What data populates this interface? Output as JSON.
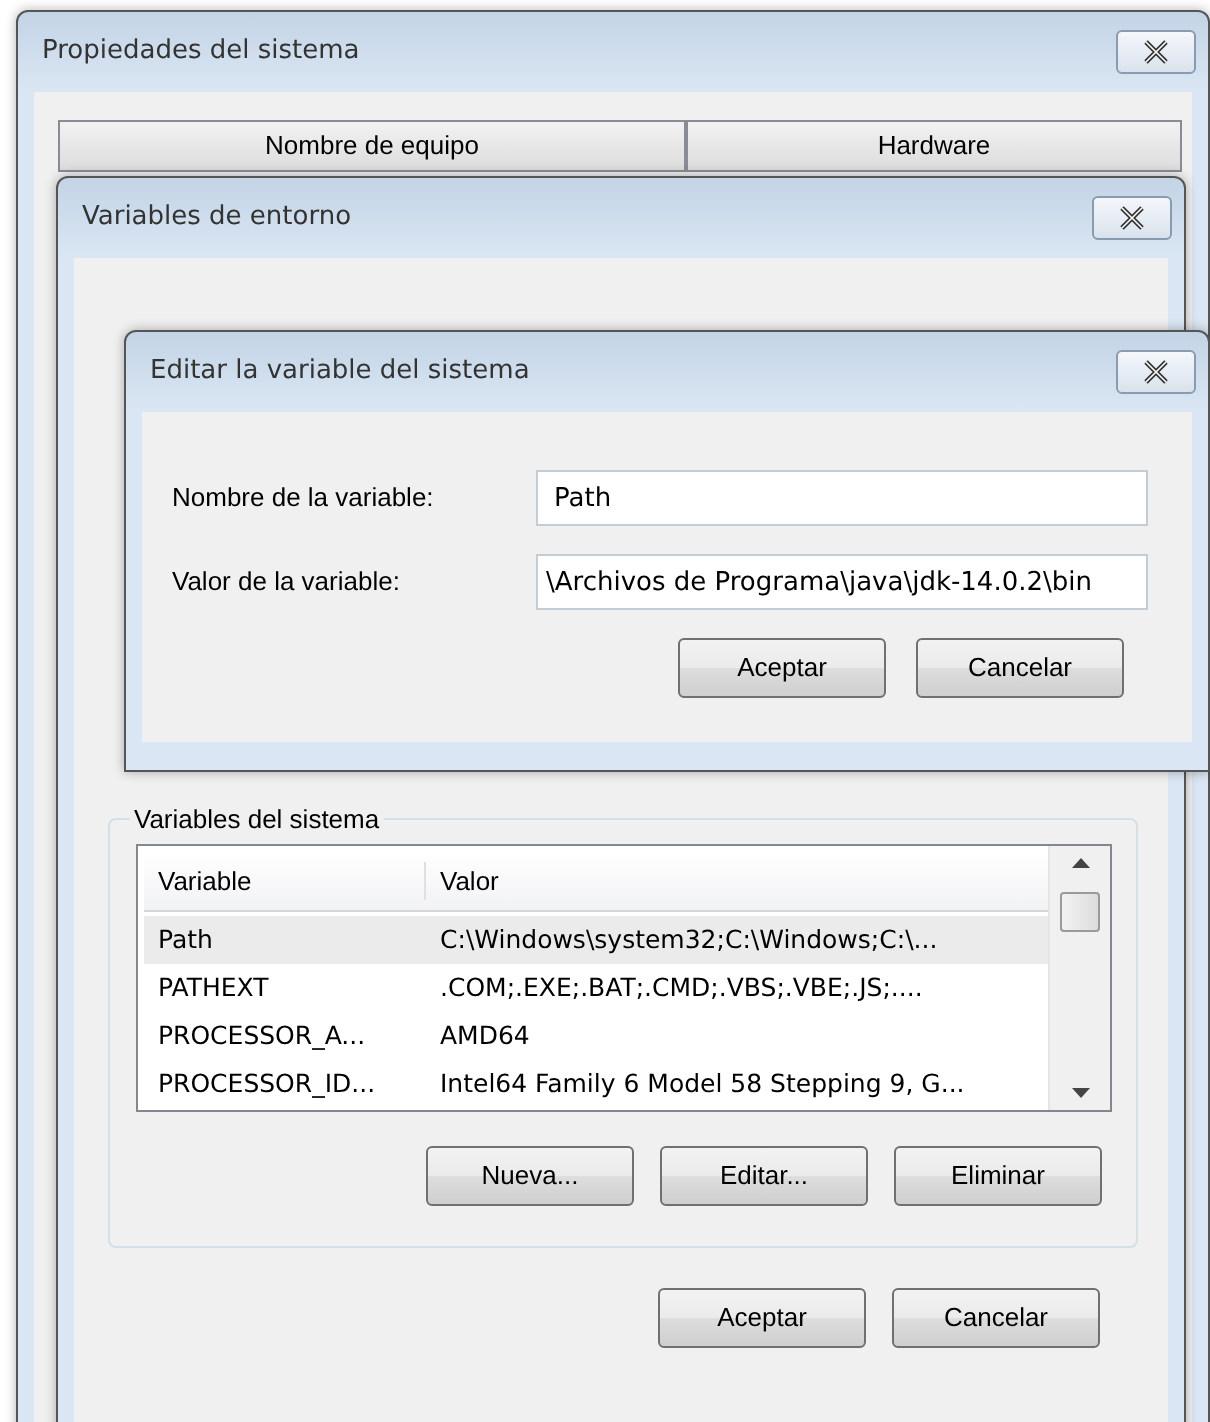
{
  "windows": [
    {
      "title": "Propiedades del sistema",
      "tabs": [
        {
          "label": "Nombre de equipo",
          "selected": false
        },
        {
          "label": "Hardware",
          "selected": false
        }
      ]
    },
    {
      "title": "Variables de entorno",
      "group": {
        "legend": "Variables del sistema",
        "columns": [
          "Variable",
          "Valor"
        ],
        "rows": [
          {
            "cells": [
              "Path",
              "C:\\Windows\\system32;C:\\Windows;C:\\..."
            ],
            "selected": true
          },
          {
            "cells": [
              "PATHEXT",
              ".COM;.EXE;.BAT;.CMD;.VBS;.VBE;.JS;...."
            ],
            "selected": false
          },
          {
            "cells": [
              "PROCESSOR_A...",
              "AMD64"
            ],
            "selected": false
          },
          {
            "cells": [
              "PROCESSOR_ID...",
              "Intel64 Family 6 Model 58 Stepping 9, G..."
            ],
            "selected": false
          }
        ],
        "buttons": [
          "Nueva...",
          "Editar...",
          "Eliminar"
        ]
      },
      "buttons": [
        "Aceptar",
        "Cancelar"
      ]
    },
    {
      "title": "Editar la variable del sistema",
      "fields": [
        {
          "label": "Nombre de la variable:",
          "value": "Path"
        },
        {
          "label": "Valor de la variable:",
          "value": "\\Archivos de Programa\\java\\jdk-14.0.2\\bin"
        }
      ],
      "buttons": [
        "Aceptar",
        "Cancelar"
      ]
    }
  ]
}
